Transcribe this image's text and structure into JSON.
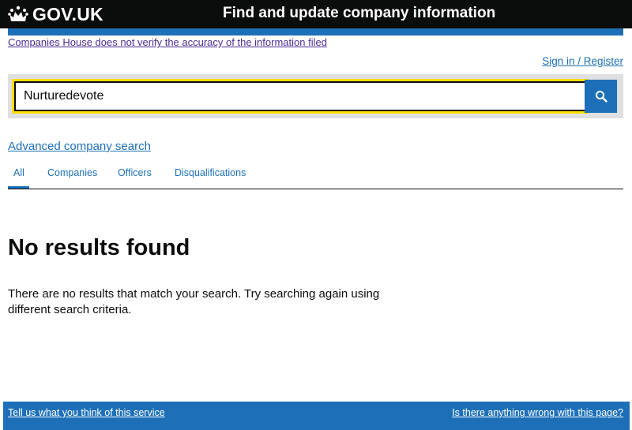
{
  "header": {
    "logo_text": "GOV.UK",
    "service_name": "Find and update company information"
  },
  "disclaimer": "Companies House does not verify the accuracy of the information filed",
  "account": {
    "signin_label": "Sign in / Register"
  },
  "search": {
    "value": "Nurturedevote",
    "button_icon": "search-icon"
  },
  "advanced_search_label": "Advanced company search",
  "tabs": [
    {
      "label": "All",
      "active": true
    },
    {
      "label": "Companies",
      "active": false
    },
    {
      "label": "Officers",
      "active": false
    },
    {
      "label": "Disqualifications",
      "active": false
    }
  ],
  "results": {
    "heading": "No results found",
    "message": "There are no results that match your search. Try searching again using different search criteria."
  },
  "footer": {
    "feedback_label": "Tell us what you think of this service",
    "report_label": "Is there anything wrong with this page?"
  },
  "colors": {
    "header_bg": "#0b0c0c",
    "brand_blue": "#1d70b8",
    "focus_yellow": "#ffdd00",
    "visited_link": "#4c2c92"
  }
}
